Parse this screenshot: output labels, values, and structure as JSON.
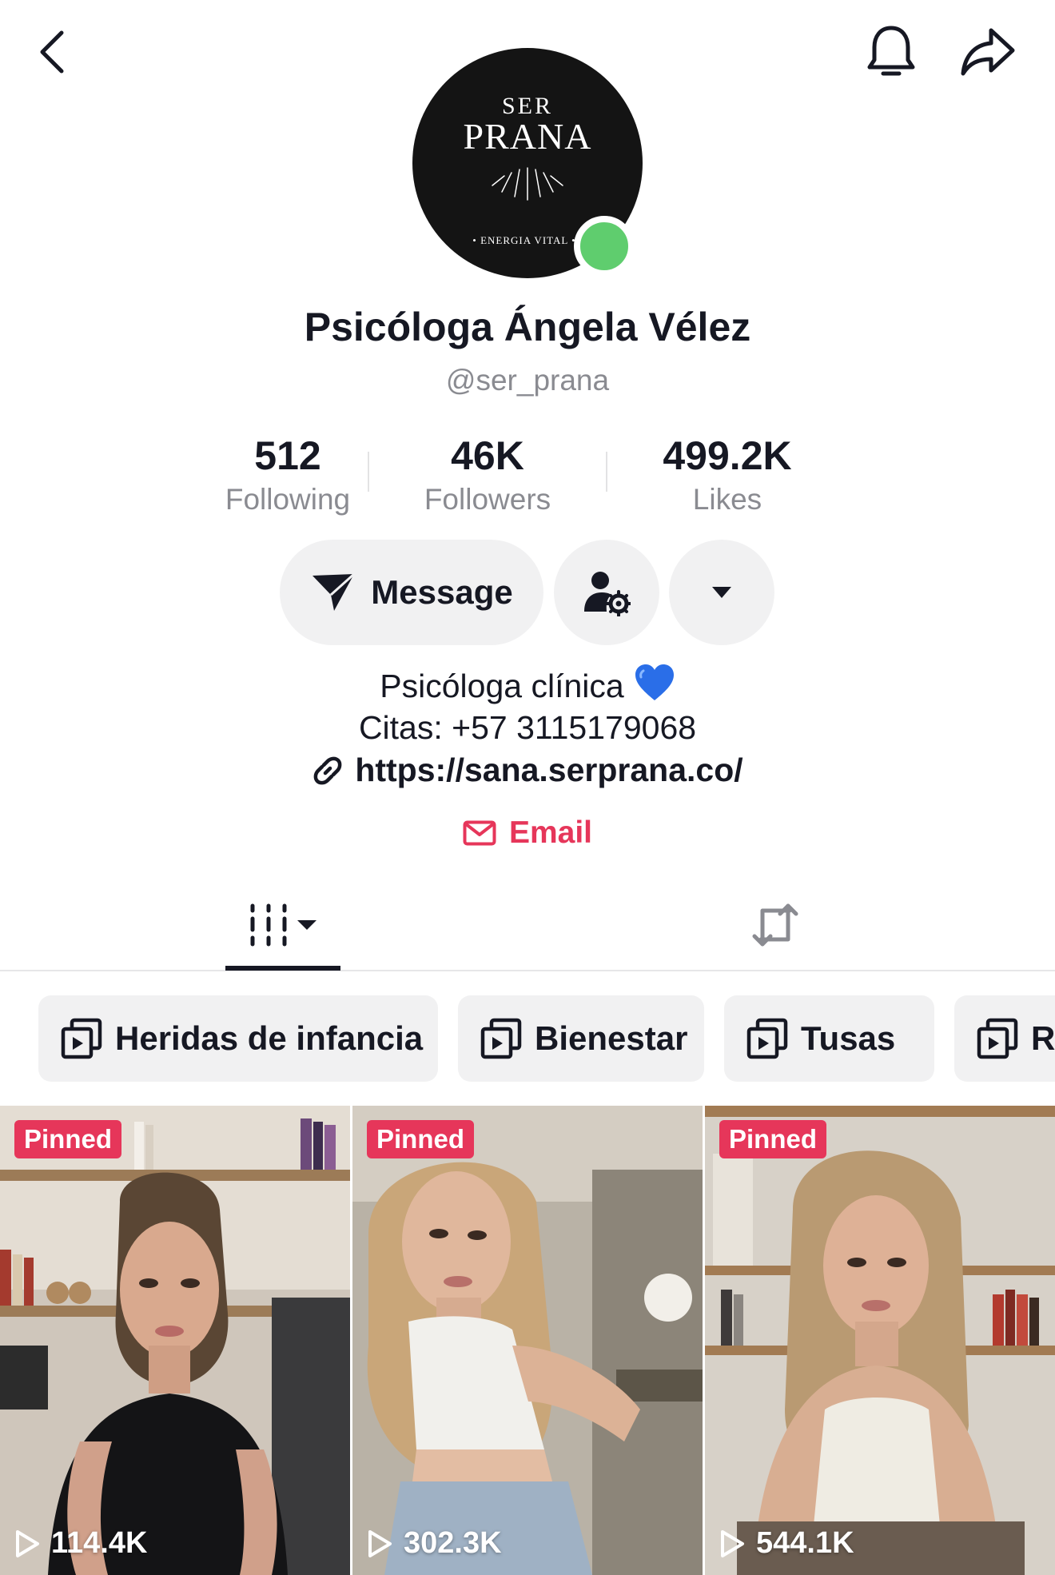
{
  "profile": {
    "avatar_logo_line1": "SER",
    "avatar_logo_line2": "PRANA",
    "avatar_logo_tagline": "• ENERGIA VITAL •",
    "display_name": "Psicóloga Ángela Vélez",
    "handle": "@ser_prana",
    "online_color": "#5fcd6e"
  },
  "stats": {
    "following_value": "512",
    "following_label": "Following",
    "followers_value": "46K",
    "followers_label": "Followers",
    "likes_value": "499.2K",
    "likes_label": "Likes"
  },
  "actions": {
    "message_label": "Message",
    "message_icon": "send-icon",
    "follow_settings_icon": "person-gear-icon",
    "more_icon": "caret-down-icon"
  },
  "bio": {
    "line1": "Psicóloga clínica",
    "line1_emoji": "blue-heart-icon",
    "line2": "Citas: +57 3115179068",
    "website": "https://sana.serprana.co/",
    "email_label": "Email"
  },
  "tabs": [
    {
      "name": "videos",
      "icon": "grid-columns-icon",
      "active": true
    },
    {
      "name": "reposts",
      "icon": "repost-icon",
      "active": false
    }
  ],
  "playlists": [
    {
      "label": "Heridas de infancia"
    },
    {
      "label": "Bienestar"
    },
    {
      "label": "Tusas"
    },
    {
      "label": "Re"
    }
  ],
  "videos": [
    {
      "badge": "Pinned",
      "views": "114.4K"
    },
    {
      "badge": "Pinned",
      "views": "302.3K"
    },
    {
      "badge": "Pinned",
      "views": "544.1K"
    }
  ],
  "colors": {
    "accent": "#e6365a",
    "text_primary": "#161823",
    "text_secondary": "#8a8b91",
    "button_bg": "#f1f1f2"
  }
}
